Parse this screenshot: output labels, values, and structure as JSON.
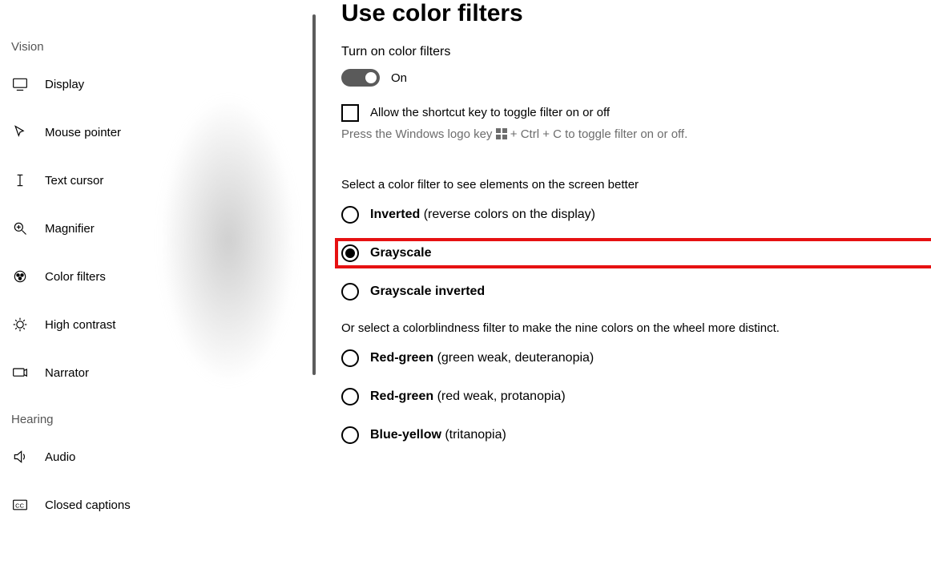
{
  "sidebar": {
    "groups": [
      {
        "title": "Vision",
        "items": [
          {
            "id": "display",
            "label": "Display"
          },
          {
            "id": "mouse-pointer",
            "label": "Mouse pointer"
          },
          {
            "id": "text-cursor",
            "label": "Text cursor"
          },
          {
            "id": "magnifier",
            "label": "Magnifier"
          },
          {
            "id": "color-filters",
            "label": "Color filters"
          },
          {
            "id": "high-contrast",
            "label": "High contrast"
          },
          {
            "id": "narrator",
            "label": "Narrator"
          }
        ]
      },
      {
        "title": "Hearing",
        "items": [
          {
            "id": "audio",
            "label": "Audio"
          },
          {
            "id": "closed-captions",
            "label": "Closed captions"
          }
        ]
      }
    ]
  },
  "main": {
    "title": "Use color filters",
    "toggle": {
      "heading": "Turn on color filters",
      "state_label": "On",
      "on": true
    },
    "shortcut": {
      "label": "Allow the shortcut key to toggle filter on or off",
      "hint_prefix": "Press the Windows logo key ",
      "hint_suffix": " + Ctrl + C to toggle filter on or off."
    },
    "filters": {
      "heading": "Select a color filter to see elements on the screen better",
      "options": [
        {
          "id": "inverted",
          "name": "Inverted",
          "note": " (reverse colors on the display)",
          "selected": false
        },
        {
          "id": "grayscale",
          "name": "Grayscale",
          "note": "",
          "selected": true,
          "highlight": true
        },
        {
          "id": "grayscale-inverted",
          "name": "Grayscale inverted",
          "note": "",
          "selected": false
        }
      ]
    },
    "colorblind": {
      "heading": "Or select a colorblindness filter to make the nine colors on the wheel more distinct.",
      "options": [
        {
          "id": "deuteranopia",
          "name": "Red-green",
          "note": " (green weak, deuteranopia)",
          "selected": false
        },
        {
          "id": "protanopia",
          "name": "Red-green",
          "note": " (red weak, protanopia)",
          "selected": false
        },
        {
          "id": "tritanopia",
          "name": "Blue-yellow",
          "note": " (tritanopia)",
          "selected": false
        }
      ]
    }
  }
}
